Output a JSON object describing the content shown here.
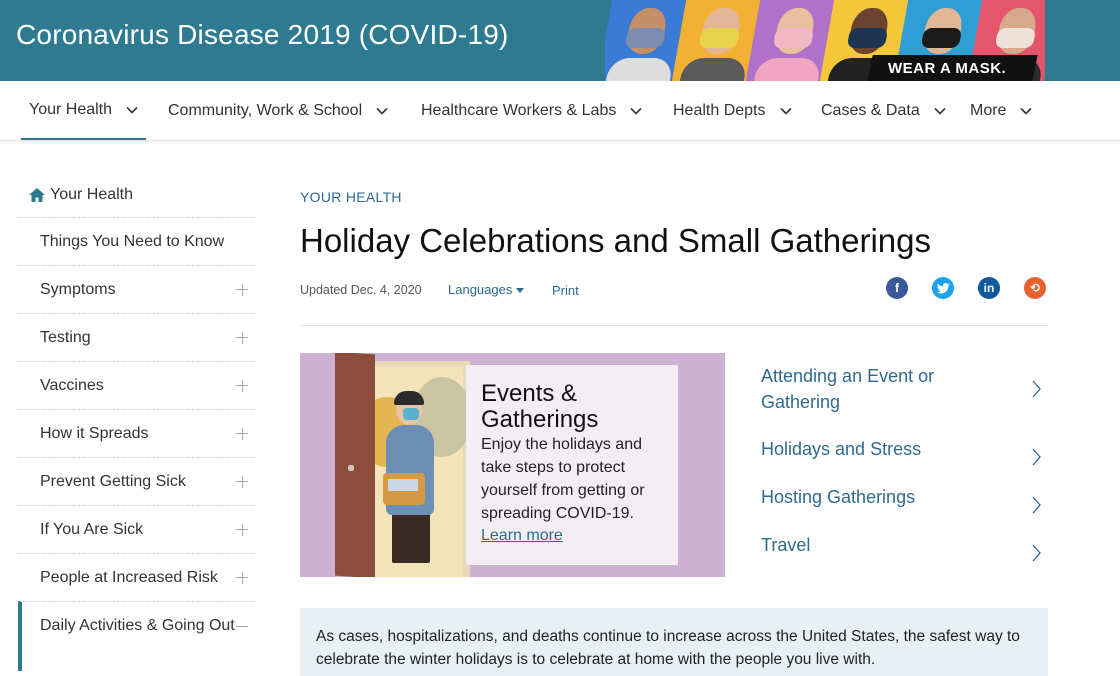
{
  "header": {
    "title": "Coronavirus Disease 2019 (COVID-19)",
    "banner_tagline": "WEAR A MASK.",
    "banner_colors": [
      "#3a7bd5",
      "#f2b134",
      "#b071c9",
      "#f5c73a",
      "#2f9ed4",
      "#e5556b"
    ]
  },
  "topnav": {
    "items": [
      {
        "label": "Your Health",
        "active": true
      },
      {
        "label": "Community, Work & School",
        "active": false
      },
      {
        "label": "Healthcare Workers & Labs",
        "active": false
      },
      {
        "label": "Health Depts",
        "active": false
      },
      {
        "label": "Cases & Data",
        "active": false
      },
      {
        "label": "More",
        "active": false
      }
    ]
  },
  "sidebar": {
    "home_label": "Your Health",
    "items": [
      {
        "label": "Things You Need to Know",
        "expand": "none"
      },
      {
        "label": "Symptoms",
        "expand": "plus"
      },
      {
        "label": "Testing",
        "expand": "plus"
      },
      {
        "label": "Vaccines",
        "expand": "plus"
      },
      {
        "label": "How it Spreads",
        "expand": "plus"
      },
      {
        "label": "Prevent Getting Sick",
        "expand": "plus"
      },
      {
        "label": "If You Are Sick",
        "expand": "plus"
      },
      {
        "label": "People at Increased Risk",
        "expand": "plus"
      },
      {
        "label": "Daily Activities & Going Out",
        "expand": "minus",
        "active": true
      }
    ]
  },
  "main": {
    "eyebrow": "YOUR HEALTH",
    "title": "Holiday Celebrations and Small Gatherings",
    "updated": "Updated Dec. 4, 2020",
    "languages_label": "Languages",
    "print_label": "Print",
    "social": [
      {
        "name": "facebook",
        "glyph": "f",
        "color": "#3b5998"
      },
      {
        "name": "twitter",
        "glyph": "t",
        "color": "#1da1f2"
      },
      {
        "name": "linkedin",
        "glyph": "in",
        "color": "#0e5a9c"
      },
      {
        "name": "syndicate",
        "glyph": "⟲",
        "color": "#e8612c"
      }
    ],
    "feature": {
      "title": "Events & Gatherings",
      "body": "Enjoy the holidays and take steps to protect yourself from getting or spreading COVID-19.",
      "link": "Learn more"
    },
    "right_links": [
      {
        "label": "Attending an Event or Gathering"
      },
      {
        "label": "Holidays and Stress"
      },
      {
        "label": "Hosting Gatherings"
      },
      {
        "label": "Travel"
      }
    ],
    "callout": "As cases, hospitalizations, and deaths continue to increase across the United States, the safest way to celebrate the winter holidays is to celebrate at home with the people you live with."
  }
}
